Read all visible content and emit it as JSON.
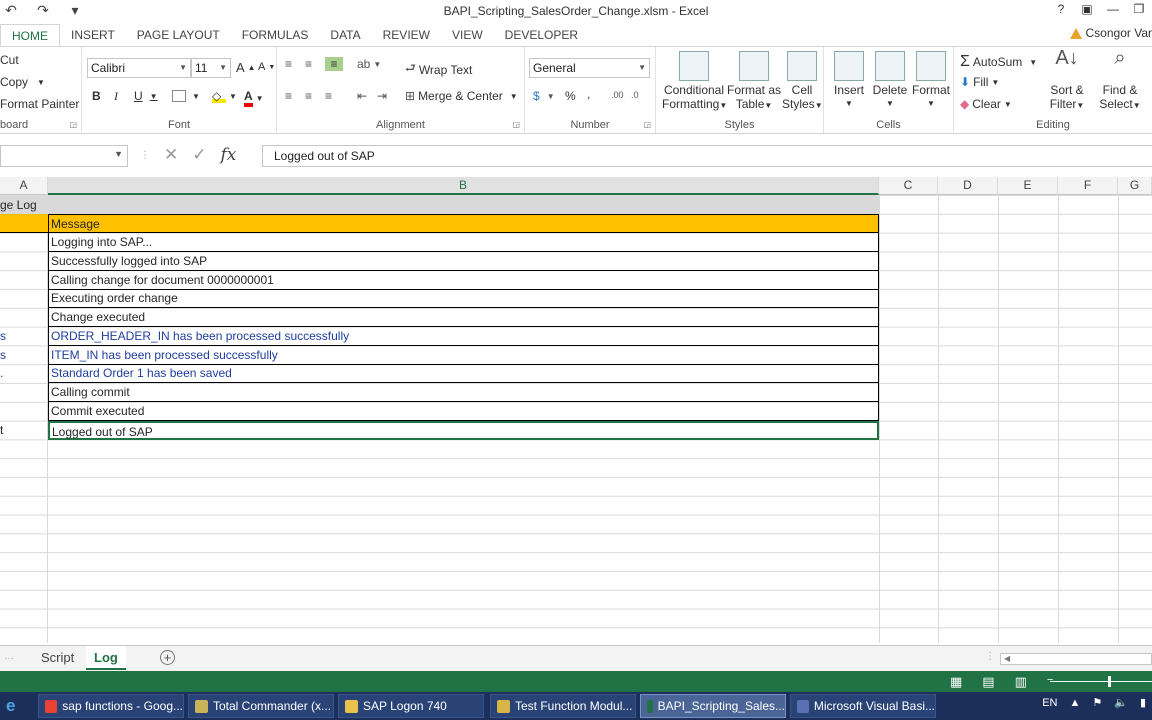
{
  "window": {
    "title": "BAPI_Scripting_SalesOrder_Change.xlsm - Excel",
    "help_icon": "?",
    "user": "Csongor Var"
  },
  "ribbon_tabs": [
    "HOME",
    "INSERT",
    "PAGE LAYOUT",
    "FORMULAS",
    "DATA",
    "REVIEW",
    "VIEW",
    "DEVELOPER"
  ],
  "clipboard": {
    "cut": "Cut",
    "copy": "Copy",
    "format_painter": "Format Painter",
    "label": "board"
  },
  "font": {
    "name": "Calibri",
    "size": "11",
    "label": "Font"
  },
  "alignment": {
    "wrap_text": "Wrap Text",
    "merge_center": "Merge & Center",
    "label": "Alignment"
  },
  "number": {
    "format": "General",
    "label": "Number"
  },
  "styles": {
    "conditional": "Conditional",
    "conditional2": "Formatting",
    "format_as": "Format as",
    "table": "Table",
    "cell": "Cell",
    "cell2": "Styles",
    "label": "Styles"
  },
  "cells": {
    "insert": "Insert",
    "delete": "Delete",
    "format": "Format",
    "label": "Cells"
  },
  "editing": {
    "autosum": "AutoSum",
    "fill": "Fill",
    "clear": "Clear",
    "sort": "Sort &",
    "sort2": "Filter",
    "find": "Find &",
    "find2": "Select",
    "label": "Editing"
  },
  "formula_bar": {
    "value": "Logged out of SAP"
  },
  "columns": [
    "A",
    "B",
    "C",
    "D",
    "E",
    "F",
    "G"
  ],
  "sheet": {
    "title_fragment": "ge Log",
    "header": "Message",
    "rows": [
      {
        "a": "",
        "b": "Logging into SAP...",
        "blue": false
      },
      {
        "a": "",
        "b": "Successfully logged into SAP",
        "blue": false
      },
      {
        "a": "",
        "b": "Calling change for document 0000000001",
        "blue": false
      },
      {
        "a": "",
        "b": "Executing order change",
        "blue": false
      },
      {
        "a": "",
        "b": "Change executed",
        "blue": false
      },
      {
        "a": "s",
        "b": "ORDER_HEADER_IN has been processed successfully",
        "blue": true
      },
      {
        "a": "s",
        "b": "ITEM_IN has been processed successfully",
        "blue": true
      },
      {
        "a": ".",
        "b": "Standard Order 1 has been saved",
        "blue": true
      },
      {
        "a": "",
        "b": "Calling commit",
        "blue": false
      },
      {
        "a": "",
        "b": "Commit executed",
        "blue": false
      },
      {
        "a": "t",
        "b": "Logged out of SAP",
        "blue": false
      }
    ]
  },
  "sheet_tabs": [
    "Script",
    "Log"
  ],
  "taskbar": [
    {
      "label": "sap functions - Goog...",
      "color": "#e94235"
    },
    {
      "label": "Total Commander (x...",
      "color": "#c9b25a"
    },
    {
      "label": "SAP Logon 740",
      "color": "#e8c24a"
    },
    {
      "label": "Test Function Modul...",
      "color": "#d9b547"
    },
    {
      "label": "BAPI_Scripting_Sales...",
      "color": "#217346"
    },
    {
      "label": "Microsoft Visual Basi...",
      "color": "#5b6fb5"
    }
  ],
  "tray": {
    "lang": "EN"
  },
  "colors": {
    "accent": "#217346",
    "header_fill": "#ffc000",
    "title_fill": "#d9d9d9",
    "blue_text": "#1f3e9e"
  }
}
